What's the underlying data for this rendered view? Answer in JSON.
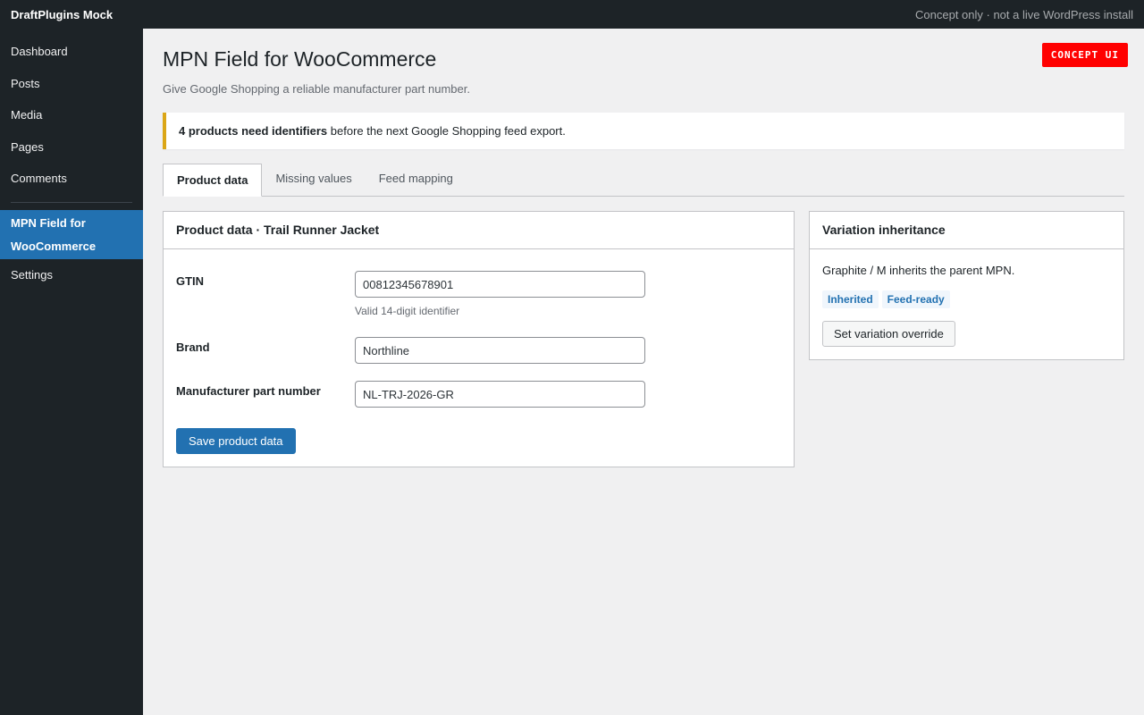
{
  "adminbar": {
    "site_name": "DraftPlugins Mock",
    "note": "Concept only · not a live WordPress install"
  },
  "sidebar": {
    "items": [
      {
        "label": "Dashboard"
      },
      {
        "label": "Posts"
      },
      {
        "label": "Media"
      },
      {
        "label": "Pages"
      },
      {
        "label": "Comments"
      }
    ],
    "active_item": "MPN Field for WooCommerce",
    "settings": "Settings"
  },
  "page": {
    "title": "MPN Field for WooCommerce",
    "subtitle": "Give Google Shopping a reliable manufacturer part number.",
    "badge": "CONCEPT UI"
  },
  "notice": {
    "bold": "4 products need identifiers",
    "rest": " before the next Google Shopping feed export.",
    "accent_color": "#dba617"
  },
  "tabs": [
    {
      "label": "Product data",
      "active": true
    },
    {
      "label": "Missing values",
      "active": false
    },
    {
      "label": "Feed mapping",
      "active": false
    }
  ],
  "product_panel": {
    "title": "Product data · Trail Runner Jacket",
    "fields": [
      {
        "label": "GTIN",
        "value": "00812345678901",
        "help": "Valid 14-digit identifier"
      },
      {
        "label": "Brand",
        "value": "Northline"
      },
      {
        "label": "Manufacturer part number",
        "value": "NL-TRJ-2026-GR"
      }
    ],
    "save_label": "Save product data"
  },
  "variation_panel": {
    "title": "Variation inheritance",
    "text": "Graphite / M inherits the parent MPN.",
    "tags": [
      "Inherited",
      "Feed-ready"
    ],
    "override_label": "Set variation override"
  },
  "colors": {
    "primary": "#2271b1",
    "admin_dark": "#1d2327",
    "badge": "#ff0000"
  }
}
